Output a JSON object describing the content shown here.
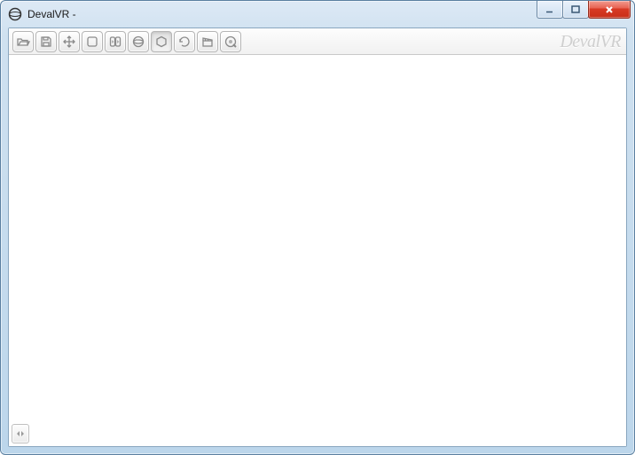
{
  "window": {
    "title": "DevalVR -"
  },
  "toolbar": {
    "brand": "DevalVR",
    "buttons": [
      {
        "name": "open",
        "active": false
      },
      {
        "name": "save",
        "active": false
      },
      {
        "name": "move",
        "active": false
      },
      {
        "name": "fullscreen",
        "active": false
      },
      {
        "name": "play-panels",
        "active": false
      },
      {
        "name": "sphere",
        "active": false
      },
      {
        "name": "hexagon",
        "active": true
      },
      {
        "name": "rotate",
        "active": false
      },
      {
        "name": "clapper",
        "active": false
      },
      {
        "name": "quicktime",
        "active": false
      }
    ]
  }
}
